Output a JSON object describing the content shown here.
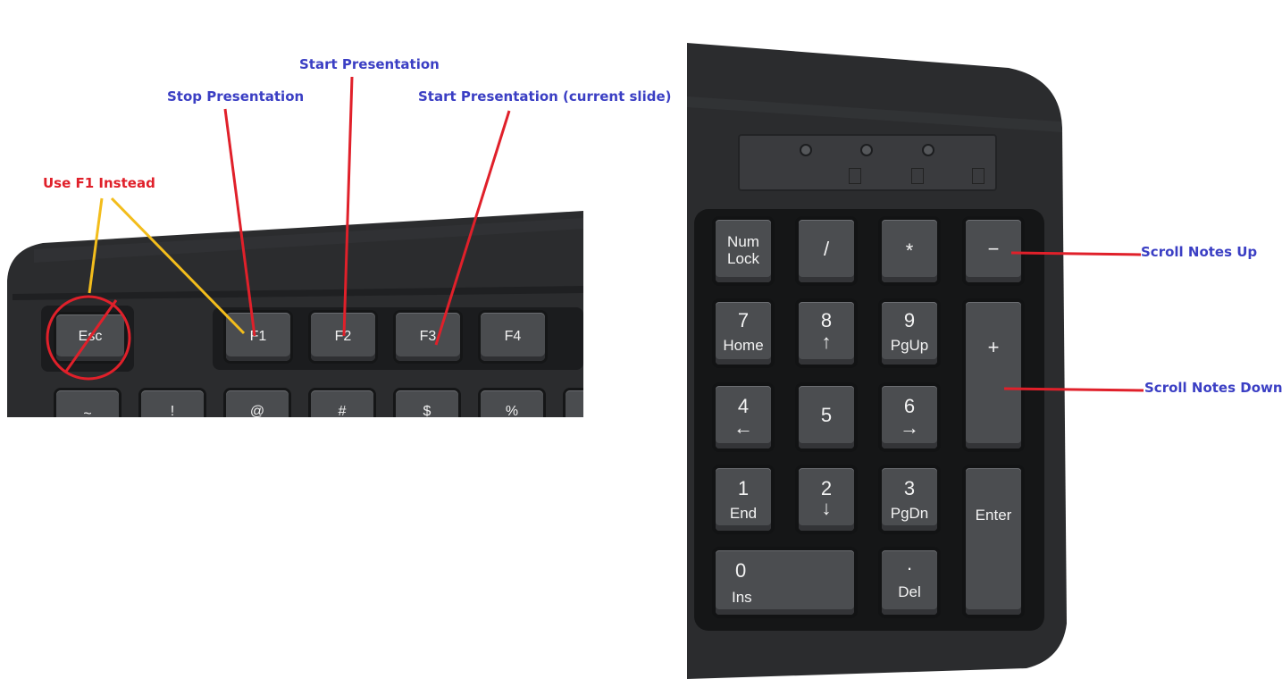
{
  "annotations": {
    "use_f1_instead": "Use F1 Instead",
    "stop_presentation": "Stop Presentation",
    "start_presentation": "Start Presentation",
    "start_presentation_current": "Start Presentation (current slide)",
    "scroll_notes_up": "Scroll Notes Up",
    "scroll_notes_down": "Scroll Notes Down"
  },
  "colors": {
    "label_blue": "#3b3fc4",
    "label_red": "#e0202a",
    "pointer_red": "#e0202a",
    "pointer_yellow": "#f3bd1c",
    "keyboard_dark": "#2a2b2d"
  },
  "function_row": {
    "esc": "Esc",
    "f1": "F1",
    "f2": "F2",
    "f3": "F3",
    "f4": "F4"
  },
  "number_row": [
    "~",
    "!",
    "@",
    "#",
    "$",
    "%"
  ],
  "numpad": {
    "numlock": [
      "Num",
      "Lock"
    ],
    "slash": "/",
    "asterisk": "*",
    "minus": "−",
    "k7": [
      "7",
      "Home"
    ],
    "k8": [
      "8",
      "↑"
    ],
    "k9": [
      "9",
      "PgUp"
    ],
    "plus": "+",
    "k4": [
      "4",
      "←"
    ],
    "k5": "5",
    "k6": [
      "6",
      "→"
    ],
    "k1": [
      "1",
      "End"
    ],
    "k2": [
      "2",
      "↓"
    ],
    "k3": [
      "3",
      "PgDn"
    ],
    "enter": "Enter",
    "k0": [
      "0",
      "Ins"
    ],
    "dot": [
      ".",
      "Del"
    ]
  }
}
